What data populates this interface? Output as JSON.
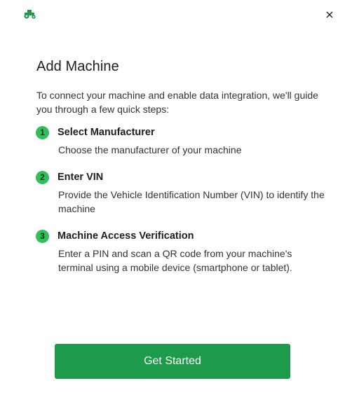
{
  "dialog": {
    "logo_icon": "tractor-icon",
    "close_icon": "close-icon",
    "accent_color": "#1e9a4b",
    "badge_color": "#2fbf5b",
    "title": "Add Machine",
    "intro": "To connect your machine and enable data integration, we'll guide you through a few quick steps:",
    "steps": [
      {
        "number": "1",
        "title": "Select Manufacturer",
        "description": "Choose the manufacturer of your machine"
      },
      {
        "number": "2",
        "title": "Enter VIN",
        "description": "Provide the Vehicle Identification Number (VIN) to identify the machine"
      },
      {
        "number": "3",
        "title": "Machine Access Verification",
        "description": "Enter a PIN and scan a QR code from your machine's terminal using a mobile device (smartphone or tablet)."
      }
    ],
    "cta_label": "Get Started"
  }
}
